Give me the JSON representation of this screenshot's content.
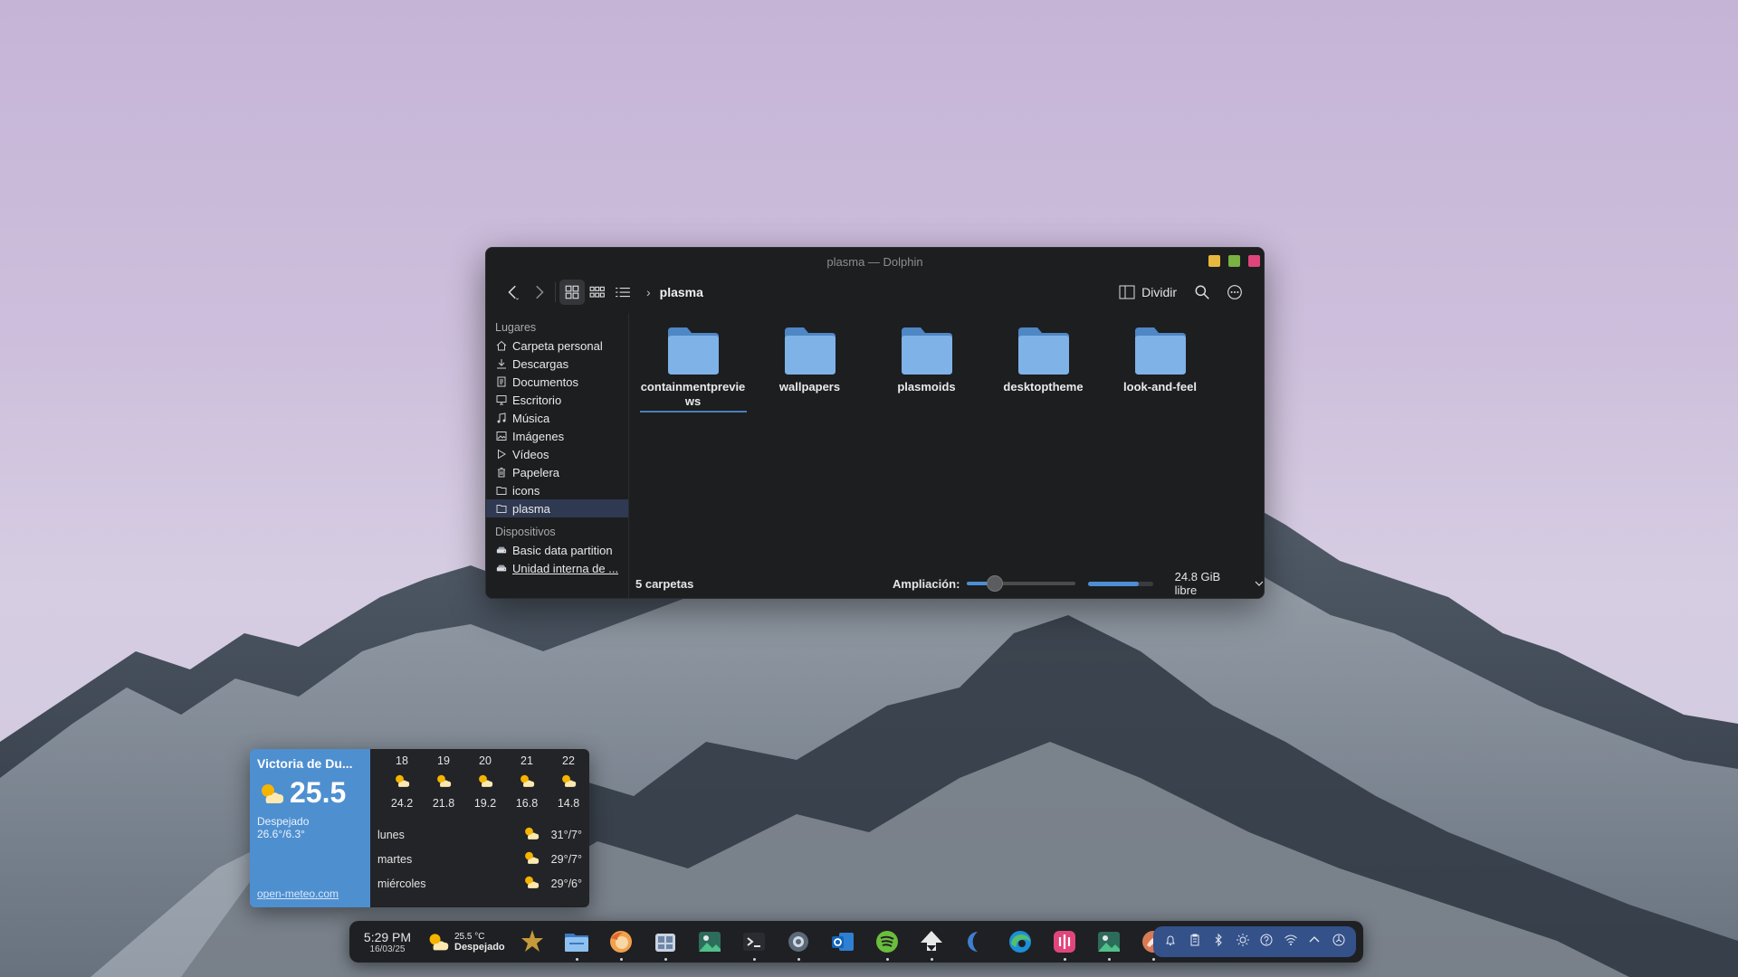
{
  "window": {
    "title": "plasma — Dolphin",
    "controls": {
      "minimize_color": "#e8b73d",
      "maximize_color": "#79b142",
      "close_color": "#e0457a"
    },
    "toolbar": {
      "back_icon": "chevron-left-icon",
      "forward_icon": "chevron-right-icon",
      "view_modes": [
        "icons-view",
        "compact-view",
        "details-view"
      ],
      "breadcrumb": "plasma",
      "split_label": "Dividir"
    },
    "sidebar": {
      "places_header": "Lugares",
      "places": [
        {
          "label": "Carpeta personal",
          "icon": "home-icon"
        },
        {
          "label": "Descargas",
          "icon": "download-icon"
        },
        {
          "label": "Documentos",
          "icon": "document-icon"
        },
        {
          "label": "Escritorio",
          "icon": "desktop-icon"
        },
        {
          "label": "Música",
          "icon": "music-icon"
        },
        {
          "label": "Imágenes",
          "icon": "image-icon"
        },
        {
          "label": "Vídeos",
          "icon": "video-icon"
        },
        {
          "label": "Papelera",
          "icon": "trash-icon"
        },
        {
          "label": "icons",
          "icon": "folder-icon"
        },
        {
          "label": "plasma",
          "icon": "folder-icon",
          "selected": true
        }
      ],
      "devices_header": "Dispositivos",
      "devices": [
        {
          "label": "Basic data partition",
          "icon": "drive-icon"
        },
        {
          "label": "Unidad interna de ...",
          "icon": "drive-icon"
        }
      ]
    },
    "folders": [
      {
        "name": "containmentpreviews",
        "selected": true
      },
      {
        "name": "wallpapers"
      },
      {
        "name": "plasmoids"
      },
      {
        "name": "desktoptheme"
      },
      {
        "name": "look-and-feel"
      }
    ],
    "status": {
      "count": "5 carpetas",
      "zoom_label": "Ampliación:",
      "zoom_level": 0.25,
      "disk_used_fraction": 0.78,
      "free_space": "24.8 GiB libre"
    }
  },
  "weather": {
    "city": "Victoria de Du...",
    "temp": "25.5",
    "condition": "Despejado",
    "range": "26.6°/6.3°",
    "source": "open-meteo.com",
    "hourly": [
      {
        "label": "18",
        "value": "24.2"
      },
      {
        "label": "19",
        "value": "21.8"
      },
      {
        "label": "20",
        "value": "19.2"
      },
      {
        "label": "21",
        "value": "16.8"
      },
      {
        "label": "22",
        "value": "14.8"
      }
    ],
    "daily": [
      {
        "day": "lunes",
        "temps": "31°/7°"
      },
      {
        "day": "martes",
        "temps": "29°/7°"
      },
      {
        "day": "miércoles",
        "temps": "29°/6°"
      }
    ]
  },
  "taskbar": {
    "time": "5:29 PM",
    "date": "16/03/25",
    "weather_temp": "25.5 °C",
    "weather_cond": "Despejado",
    "apps": [
      "kde-icon",
      "dolphin-icon",
      "firefox-icon",
      "store-icon",
      "image-viewer-icon",
      "terminal-icon",
      "settings-icon",
      "outlook-icon",
      "spotify-icon",
      "inkscape-icon",
      "half-moon-icon",
      "edge-icon",
      "audio-icon",
      "gallery-icon",
      "brave-icon"
    ],
    "tray": [
      "notification-bell-icon",
      "clipboard-icon",
      "bluetooth-icon",
      "brightness-icon",
      "help-icon",
      "wifi-icon",
      "chevron-up-icon",
      "power-icon"
    ],
    "accent": "#34518a"
  }
}
